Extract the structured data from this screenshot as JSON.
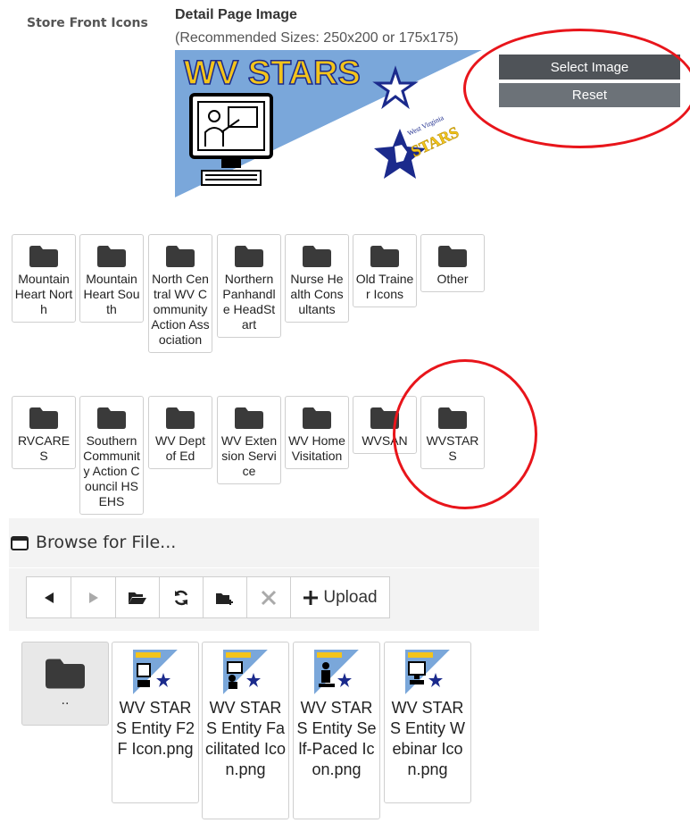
{
  "header": {
    "store_front_label": "Store Front Icons",
    "detail_title": "Detail Page Image",
    "recommended": "(Recommended Sizes: 250x200 or 175x175)"
  },
  "banner": {
    "title": "WV STARS",
    "seal_top": "West Virginia",
    "seal_bottom": "STARS"
  },
  "buttons": {
    "select_image": "Select Image",
    "reset": "Reset"
  },
  "folders_row1": [
    {
      "label": "Mountain Heart North"
    },
    {
      "label": "Mountain Heart South"
    },
    {
      "label": "North Central WV Community Action Association"
    },
    {
      "label": "Northern Panhandle HeadStart"
    },
    {
      "label": "Nurse Health Consultants"
    },
    {
      "label": "Old Trainer Icons"
    },
    {
      "label": "Other"
    }
  ],
  "folders_row2": [
    {
      "label": "RVCARES"
    },
    {
      "label": "Southern Community Action Council HSEHS"
    },
    {
      "label": "WV Dept of Ed"
    },
    {
      "label": "WV Extension Service"
    },
    {
      "label": "WV Home Visitation"
    },
    {
      "label": "WVSAN"
    },
    {
      "label": "WVSTARS"
    }
  ],
  "browser": {
    "title": "Browse for File...",
    "upload_label": "Upload",
    "parent_label": "..",
    "files": [
      {
        "label": "WV STARS Entity F2F Icon.png"
      },
      {
        "label": "WV STARS Entity Facilitated Icon.png"
      },
      {
        "label": "WV STARS Entity Self-Paced Icon.png"
      },
      {
        "label": "WV STARS Entity Webinar Icon.png"
      }
    ]
  },
  "colors": {
    "button_dark": "#4f5358",
    "button_reset": "#6c7278",
    "annotation_ring": "#e8151b",
    "banner_blue": "#7aa7da",
    "star_navy": "#1b2a8c",
    "banner_gold": "#f3c41b"
  }
}
